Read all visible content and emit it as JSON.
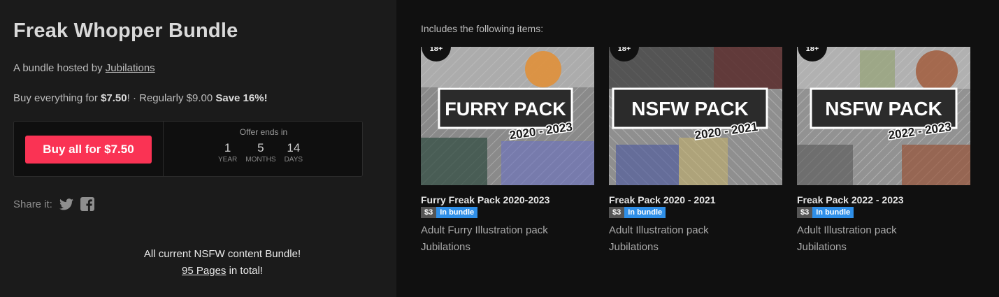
{
  "bundle": {
    "title": "Freak Whopper Bundle",
    "hosted_prefix": "A bundle hosted by ",
    "host_name": "Jubilations",
    "pricing_prefix": "Buy everything for ",
    "pricing_price": "$7.50",
    "pricing_middle": "! · Regularly $9.00 ",
    "pricing_save": "Save 16%!"
  },
  "buy": {
    "button_label": "Buy all for $7.50",
    "offer_label": "Offer ends in",
    "countdown": [
      {
        "value": "1",
        "unit": "YEAR"
      },
      {
        "value": "5",
        "unit": "MONTHS"
      },
      {
        "value": "14",
        "unit": "DAYS"
      }
    ]
  },
  "share": {
    "label": "Share it:",
    "icons": [
      "twitter-icon",
      "facebook-icon"
    ]
  },
  "description": {
    "line1": "All current NSFW content Bundle!",
    "pages_link": "95 Pages",
    "line2_suffix": " in total!"
  },
  "includes": {
    "heading": "Includes the following items:",
    "items": [
      {
        "title": "Furry Freak Pack 2020-2023",
        "price": "$3",
        "badge": "In bundle",
        "subtitle": "Adult Furry Illustration pack",
        "author": "Jubilations",
        "cover_title": "FURRY PACK",
        "cover_years": "2020 - 2023",
        "age_badge": "18+",
        "accent": "#e0903a"
      },
      {
        "title": "Freak Pack 2020 - 2021",
        "price": "$3",
        "badge": "In bundle",
        "subtitle": "Adult Illustration pack",
        "author": "Jubilations",
        "cover_title": "NSFW PACK",
        "cover_years": "2020 - 2021",
        "age_badge": "18+",
        "accent": "#6a4fa8"
      },
      {
        "title": "Freak Pack 2022 - 2023",
        "price": "$3",
        "badge": "In bundle",
        "subtitle": "Adult Illustration pack",
        "author": "Jubilations",
        "cover_title": "NSFW PACK",
        "cover_years": "2022 - 2023",
        "age_badge": "18+",
        "accent": "#b8541e"
      }
    ]
  },
  "colors": {
    "buy_button": "#fa3354",
    "bundle_badge": "#2f8fe8",
    "left_panel": "#1b1b1b",
    "right_panel": "#101010"
  }
}
